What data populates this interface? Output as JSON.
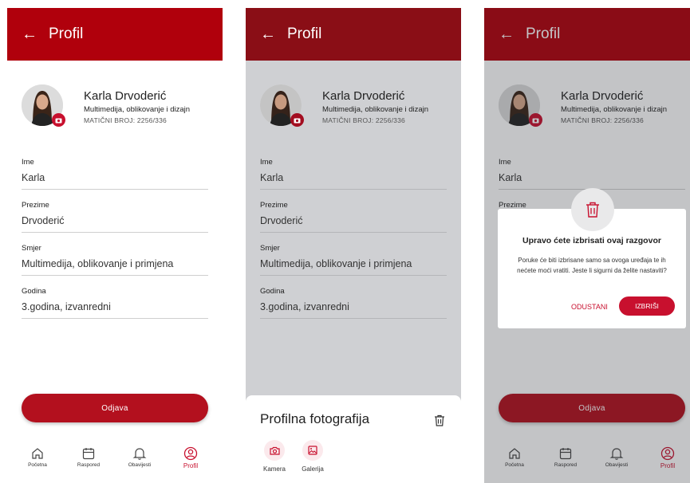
{
  "colors": {
    "accent": "#c8102e",
    "appbar_primary": "#b0000c",
    "appbar_dimmed": "#8a0e16",
    "scrim": "#cfd0d3"
  },
  "appbar": {
    "title": "Profil",
    "back_icon": "arrow-left-icon"
  },
  "profile": {
    "name": "Karla Drvoderić",
    "major": "Multimedija, oblikovanje i dizajn",
    "id_line": "MATIČNI BROJ: 2256/336"
  },
  "fields": [
    {
      "label": "Ime",
      "value": "Karla"
    },
    {
      "label": "Prezime",
      "value": "Drvoderić"
    },
    {
      "label": "Smjer",
      "value": "Multimedija, oblikovanje i primjena"
    },
    {
      "label": "Godina",
      "value": "3.godina, izvanredni"
    }
  ],
  "logout_label": "Odjava",
  "nav": [
    {
      "label": "Početna",
      "icon": "home-icon"
    },
    {
      "label": "Raspored",
      "icon": "calendar-icon"
    },
    {
      "label": "Obavijesti",
      "icon": "bell-icon"
    },
    {
      "label": "Profil",
      "icon": "user-circle-icon",
      "active": true
    }
  ],
  "photo_sheet": {
    "title": "Profilna fotografija",
    "options": [
      {
        "label": "Kamera",
        "icon": "camera-icon"
      },
      {
        "label": "Galerija",
        "icon": "gallery-icon"
      }
    ]
  },
  "dialog": {
    "title": "Upravo ćete izbrisati ovaj razgovor",
    "message": "Poruke će biti izbrisane samo sa ovoga uređaja te ih nećete moći vratiti. Jeste li sigurni da želite nastaviti?",
    "cancel": "ODUSTANI",
    "confirm": "IZBRIŠI"
  }
}
